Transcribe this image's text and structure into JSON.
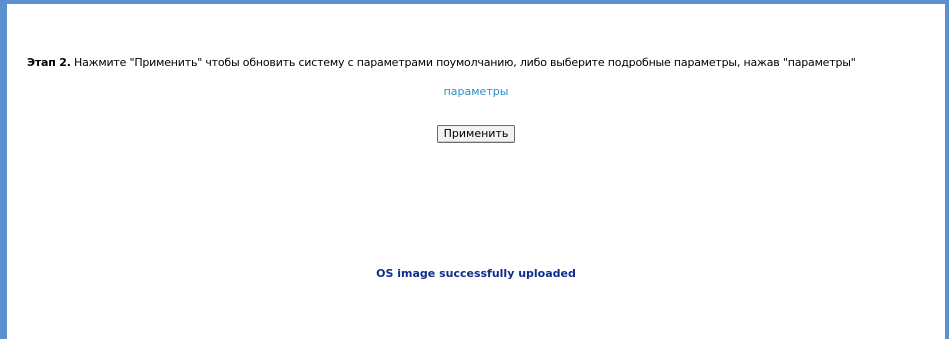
{
  "step": {
    "label": "Этап 2.",
    "text": " Нажмите \"Применить\" чтобы обновить систему с параметрами поумолчанию, либо выберите подробные параметры, нажав \"параметры\""
  },
  "params_link": {
    "label": "параметры"
  },
  "apply_button": {
    "label": "Применить"
  },
  "status": {
    "message": "OS image successfully uploaded"
  },
  "colors": {
    "frame_border": "#5b8fce",
    "link": "#2a8ec9",
    "status_text": "#0d2c8c"
  }
}
